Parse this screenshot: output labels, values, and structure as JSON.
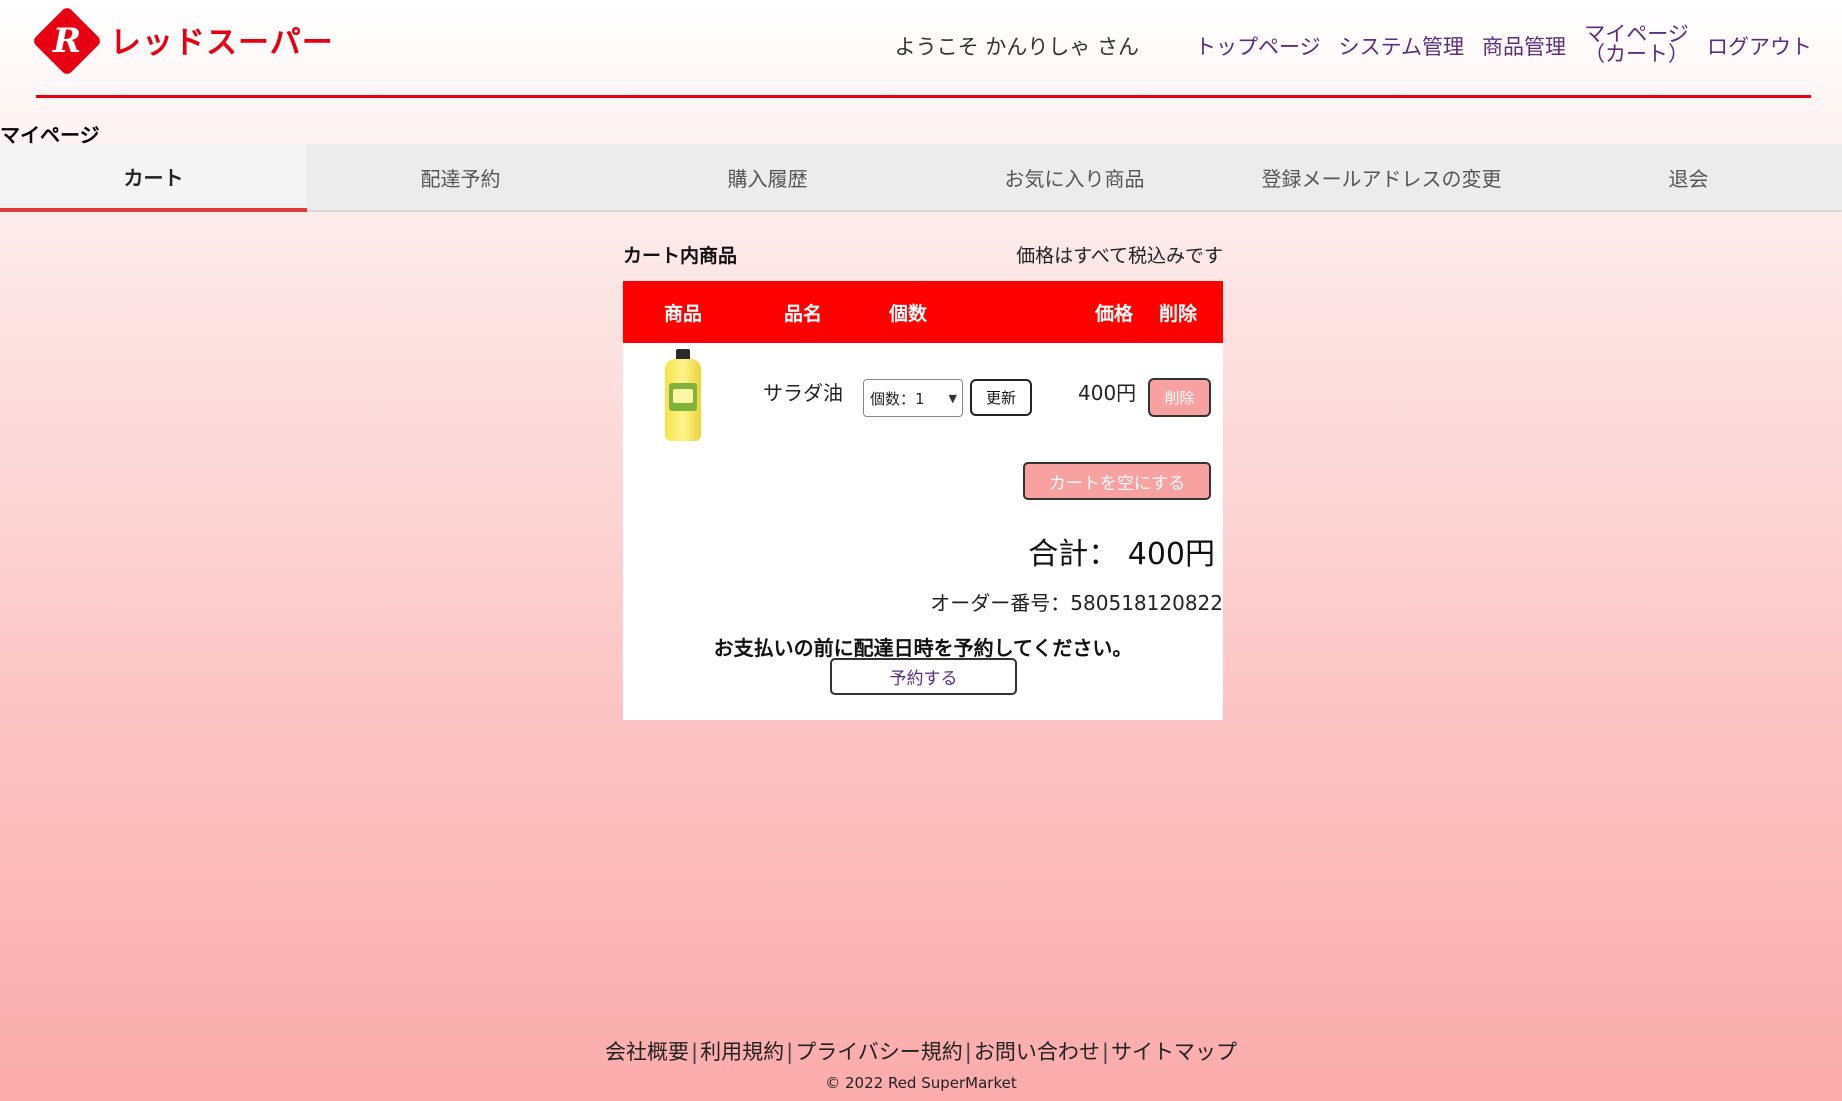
{
  "header": {
    "logo_text": "レッドスーパー",
    "logo_letter": "R",
    "welcome": "ようこそ かんりしゃ さん",
    "nav": [
      {
        "label": "トップページ"
      },
      {
        "label": "システム管理"
      },
      {
        "label": "商品管理"
      },
      {
        "label_line1": "マイページ",
        "label_line2": "（カート）"
      },
      {
        "label": "ログアウト"
      }
    ]
  },
  "page_title": "マイページ",
  "tabs": [
    {
      "label": "カート",
      "active": true
    },
    {
      "label": "配達予約"
    },
    {
      "label": "購入履歴"
    },
    {
      "label": "お気に入り商品"
    },
    {
      "label": "登録メールアドレスの変更"
    },
    {
      "label": "退会"
    }
  ],
  "cart": {
    "title": "カート内商品",
    "tax_note": "価格はすべて税込みです",
    "columns": [
      "商品",
      "品名",
      "個数",
      "価格",
      "削除"
    ],
    "items": [
      {
        "image": "salad-oil-bottle",
        "name": "サラダ油",
        "quantity": "個数：1",
        "update_label": "更新",
        "price": "400円",
        "delete_label": "削除"
      }
    ],
    "empty_cart_label": "カートを空にする",
    "total": "合計： 400円",
    "order_number": "オーダー番号：580518120822",
    "notice": "お支払いの前に配達日時を予約してください。",
    "reserve_label": "予約する"
  },
  "footer": {
    "links": [
      "会社概要",
      "利用規約",
      "プライバシー規約",
      "お問い合わせ",
      "サイトマップ"
    ],
    "separator": "|",
    "copyright": "© 2022 Red SuperMarket"
  },
  "colors": {
    "brand_red": "#e60012",
    "table_header": "#ff0000",
    "button_pink": "#f7a1a1",
    "nav_link": "#5a2f7a"
  }
}
